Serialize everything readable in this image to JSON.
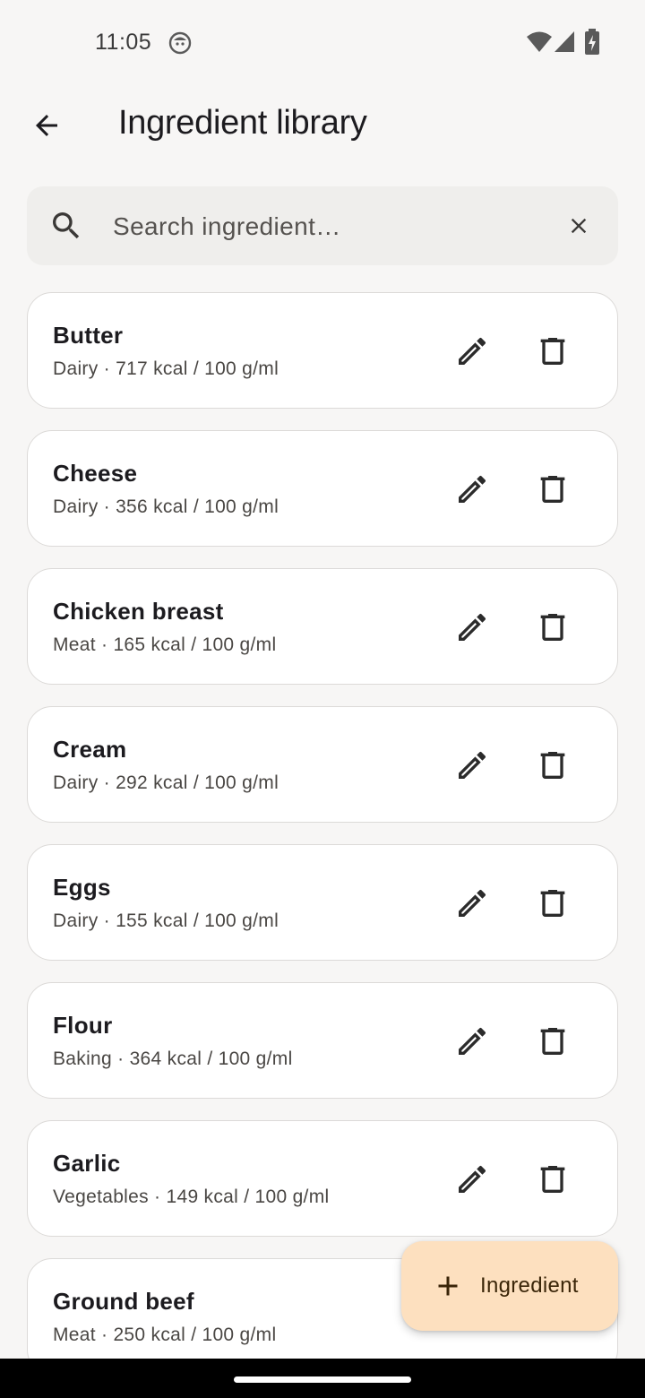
{
  "status_bar": {
    "time": "11:05",
    "icons": [
      "app-notification-icon",
      "wifi-icon",
      "signal-icon",
      "battery-charging-icon"
    ]
  },
  "header": {
    "title": "Ingredient library",
    "back_icon": "arrow-back-icon"
  },
  "search": {
    "placeholder": "Search ingredient…",
    "value": "",
    "icon": "search-icon",
    "clear_icon": "close-icon"
  },
  "ingredients": [
    {
      "name": "Butter",
      "meta": "Dairy · 717 kcal / 100 g/ml"
    },
    {
      "name": "Cheese",
      "meta": "Dairy · 356 kcal / 100 g/ml"
    },
    {
      "name": "Chicken breast",
      "meta": "Meat · 165 kcal / 100 g/ml"
    },
    {
      "name": "Cream",
      "meta": "Dairy · 292 kcal / 100 g/ml"
    },
    {
      "name": "Eggs",
      "meta": "Dairy · 155 kcal / 100 g/ml"
    },
    {
      "name": "Flour",
      "meta": "Baking · 364 kcal / 100 g/ml"
    },
    {
      "name": "Garlic",
      "meta": "Vegetables · 149 kcal / 100 g/ml"
    },
    {
      "name": "Ground beef",
      "meta": "Meat · 250 kcal / 100 g/ml"
    }
  ],
  "row_actions": {
    "edit_icon": "edit-icon",
    "delete_icon": "delete-icon"
  },
  "fab": {
    "label": "Ingredient",
    "icon": "add-icon"
  },
  "colors": {
    "background": "#f7f6f5",
    "card": "#ffffff",
    "card_border": "#dcdad8",
    "search_bg": "#efeeec",
    "fab_bg": "#fde0bf",
    "fab_text": "#3a2508",
    "icon": "#2b2b2b"
  }
}
